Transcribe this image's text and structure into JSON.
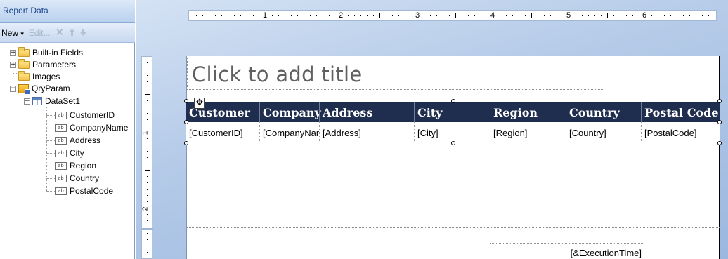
{
  "pane": {
    "title": "Report Data",
    "toolbar": {
      "new_label": "New",
      "new_dropdown": "▾",
      "edit_label": "Edit...",
      "delete_icon": "delete-icon",
      "move_up_icon": "move-up-icon",
      "move_down_icon": "move-down-icon"
    },
    "tree": {
      "built_in_fields": "Built-in Fields",
      "parameters": "Parameters",
      "images": "Images",
      "datasource": "QryParam",
      "dataset": "DataSet1",
      "fields": [
        "CustomerID",
        "CompanyName",
        "Address",
        "City",
        "Region",
        "Country",
        "PostalCode"
      ]
    }
  },
  "ruler": {
    "h_numbers": [
      "1",
      "2",
      "3",
      "4",
      "5",
      "6"
    ],
    "v_numbers": [
      "1",
      "2"
    ]
  },
  "report": {
    "title_placeholder": "Click to add title",
    "table": {
      "headers": [
        "Customer",
        "Company",
        "Address",
        "City",
        "Region",
        "Country",
        "Postal Code"
      ],
      "cells": [
        "[CustomerID]",
        "[CompanyName]",
        "[Address]",
        "[City]",
        "[Region]",
        "[Country]",
        "[PostalCode]"
      ]
    },
    "footer_expression": "[&ExecutionTime]"
  },
  "colors": {
    "header_bg": "#1f2d4f",
    "header_text": "#ffffff",
    "designer_bg": "#b5cbe8"
  }
}
